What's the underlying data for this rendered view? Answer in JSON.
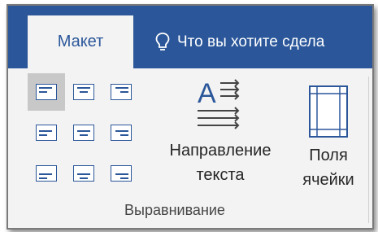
{
  "tabs": {
    "active_label": "Макет"
  },
  "tell_me": {
    "text": "Что вы хотите сдела",
    "icon": "lightbulb-icon"
  },
  "alignment": {
    "buttons": [
      {
        "icon": "align-top-left-icon",
        "selected": true
      },
      {
        "icon": "align-top-center-icon",
        "selected": false
      },
      {
        "icon": "align-top-right-icon",
        "selected": false
      },
      {
        "icon": "align-center-left-icon",
        "selected": false
      },
      {
        "icon": "align-center-center-icon",
        "selected": false
      },
      {
        "icon": "align-center-right-icon",
        "selected": false
      },
      {
        "icon": "align-bottom-left-icon",
        "selected": false
      },
      {
        "icon": "align-bottom-center-icon",
        "selected": false
      },
      {
        "icon": "align-bottom-right-icon",
        "selected": false
      }
    ]
  },
  "text_direction": {
    "label_line1": "Направление",
    "label_line2": "текста",
    "icon_letter": "A",
    "icon": "text-direction-icon"
  },
  "cell_margins": {
    "label_line1": "Поля",
    "label_line2": "ячейки",
    "icon": "cell-margins-icon"
  },
  "group": {
    "label": "Выравнивание"
  },
  "colors": {
    "accent": "#2b579a",
    "ribbon_bg": "#f3f3f3",
    "selected_bg": "#c8c8c8"
  }
}
